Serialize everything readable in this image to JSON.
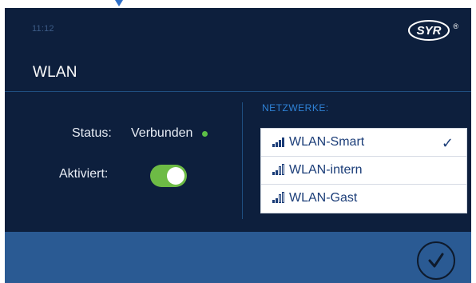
{
  "status_bar": {
    "time": "11:12"
  },
  "brand": {
    "logo_text": "SYR",
    "registered_mark": "®"
  },
  "page": {
    "title": "WLAN"
  },
  "settings": {
    "status_label": "Status:",
    "status_value": "Verbunden",
    "status_color": "#5cbf46",
    "aktiviert_label": "Aktiviert:",
    "aktiviert_on": true,
    "toggle_color": "#6dbb45"
  },
  "networks": {
    "heading": "NETZWERKE:",
    "items": [
      {
        "name": "WLAN-Smart",
        "signal_bars": 4,
        "selected": true
      },
      {
        "name": "WLAN-intern",
        "signal_bars": 2,
        "selected": false
      },
      {
        "name": "WLAN-Gast",
        "signal_bars": 2,
        "selected": false
      }
    ],
    "selected_icon": "checkmark-icon"
  },
  "footer": {
    "confirm_icon": "confirm-check-icon"
  },
  "colors": {
    "background": "#0d1f3d",
    "footer": "#2a5a93",
    "accent": "#2f82d6"
  }
}
